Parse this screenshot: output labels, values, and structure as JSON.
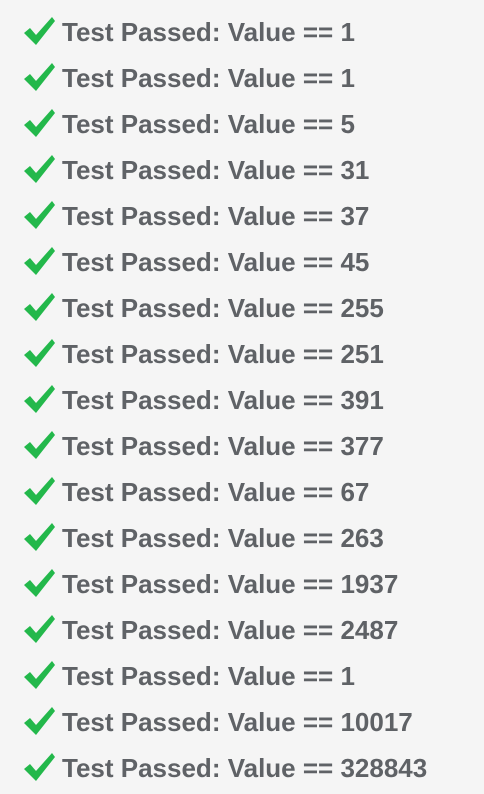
{
  "results": [
    {
      "icon": "checkmark-icon",
      "text": "Test Passed: Value == 1"
    },
    {
      "icon": "checkmark-icon",
      "text": "Test Passed: Value == 1"
    },
    {
      "icon": "checkmark-icon",
      "text": "Test Passed: Value == 5"
    },
    {
      "icon": "checkmark-icon",
      "text": "Test Passed: Value == 31"
    },
    {
      "icon": "checkmark-icon",
      "text": "Test Passed: Value == 37"
    },
    {
      "icon": "checkmark-icon",
      "text": "Test Passed: Value == 45"
    },
    {
      "icon": "checkmark-icon",
      "text": "Test Passed: Value == 255"
    },
    {
      "icon": "checkmark-icon",
      "text": "Test Passed: Value == 251"
    },
    {
      "icon": "checkmark-icon",
      "text": "Test Passed: Value == 391"
    },
    {
      "icon": "checkmark-icon",
      "text": "Test Passed: Value == 377"
    },
    {
      "icon": "checkmark-icon",
      "text": "Test Passed: Value == 67"
    },
    {
      "icon": "checkmark-icon",
      "text": "Test Passed: Value == 263"
    },
    {
      "icon": "checkmark-icon",
      "text": "Test Passed: Value == 1937"
    },
    {
      "icon": "checkmark-icon",
      "text": "Test Passed: Value == 2487"
    },
    {
      "icon": "checkmark-icon",
      "text": "Test Passed: Value == 1"
    },
    {
      "icon": "checkmark-icon",
      "text": "Test Passed: Value == 10017"
    },
    {
      "icon": "checkmark-icon",
      "text": "Test Passed: Value == 328843"
    }
  ],
  "colors": {
    "background": "#f5f5f5",
    "text": "#5f6266",
    "check": "#23b84b"
  }
}
